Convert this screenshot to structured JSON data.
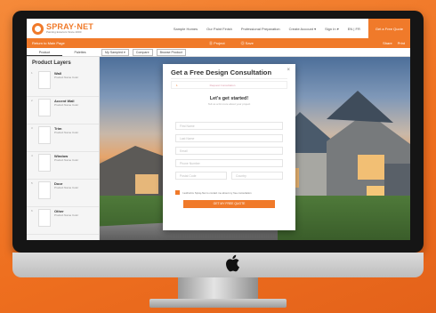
{
  "brand": {
    "logo_text": "SPRAY·NET",
    "logo_sub": "Painting Exteriors Since 2000"
  },
  "topnav": {
    "links": [
      "Sample Homes",
      "Our Paint Finish",
      "Professional Preparation",
      "Create Account ▾",
      "Sign In ▾",
      "EN | FR"
    ],
    "cta": "Get a Free Quote"
  },
  "orangebar": {
    "left": "Return to Main Page",
    "center": [
      "Ⓞ Project",
      "Ⓞ Save"
    ],
    "right": [
      "Share",
      "Print"
    ]
  },
  "subtabs": {
    "tabs": [
      "Product",
      "Palettes"
    ],
    "tools": [
      "My Sampled ▾",
      "Compare",
      "Browse Product"
    ]
  },
  "sidebar": {
    "title": "Product Layers",
    "layers": [
      {
        "num": "1",
        "name": "Wall",
        "sub": "Product Name Color"
      },
      {
        "num": "2",
        "name": "Accent Wall",
        "sub": "Product Name Color"
      },
      {
        "num": "3",
        "name": "Trim",
        "sub": "Product Name Color"
      },
      {
        "num": "4",
        "name": "Window",
        "sub": "Product Name Color"
      },
      {
        "num": "5",
        "name": "Door",
        "sub": "Product Name Color"
      },
      {
        "num": "6",
        "name": "Other",
        "sub": "Product Name Color"
      }
    ]
  },
  "modal": {
    "title": "Get a Free Design Consultation",
    "close": "×",
    "step_marker": "1",
    "step_label": "Request Consultation",
    "heading": "Let's get started!",
    "subheading": "Tell us a bit more about your project",
    "fields": [
      "First Name",
      "Last Name",
      "Email",
      "Phone Number",
      "Postal Code",
      "Country"
    ],
    "consent": "I authorize Spray-Net to contact me about my free consultation",
    "submit": "GET MY FREE QUOTE"
  },
  "colors": {
    "accent": "#f07a2a",
    "bezel": "#151515"
  }
}
